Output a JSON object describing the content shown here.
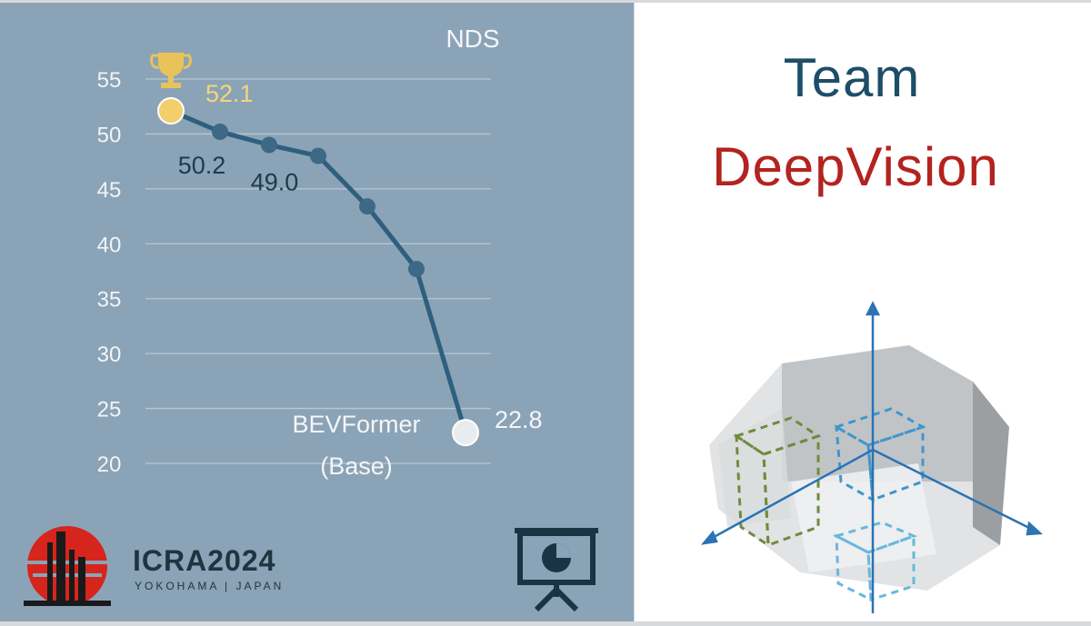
{
  "chart_data": {
    "type": "line",
    "title": "NDS",
    "y_ticks": [
      "55",
      "50",
      "45",
      "40",
      "35",
      "30",
      "25",
      "20"
    ],
    "ylim": [
      20,
      55
    ],
    "grid": true,
    "series": [
      {
        "values": [
          52.1,
          50.2,
          49.0,
          48.0,
          43.4,
          37.7,
          22.8
        ],
        "point_colors": [
          "#f2cf6b",
          "#3d6986",
          "#3d6986",
          "#3d6986",
          "#3d6986",
          "#3d6986",
          "#e9ecef"
        ]
      }
    ],
    "annotations": [
      {
        "point": 0,
        "text": "52.1",
        "color": "#f5d57c"
      },
      {
        "point": 1,
        "text": "50.2",
        "color": "#1f3a4c"
      },
      {
        "point": 2,
        "text": "49.0",
        "color": "#1f3a4c"
      },
      {
        "point": 6,
        "text": "22.8",
        "color": "#f4f6f8"
      }
    ],
    "baseline_label": {
      "line1": "BEVFormer",
      "line2": "(Base)"
    },
    "trophy_icon": "trophy-icon",
    "line_color": "#2f5f7f"
  },
  "team": {
    "line1": "Team",
    "line2": "DeepVision"
  },
  "logo": {
    "name": "ICRA2024",
    "sub": "YOKOHAMA | JAPAN"
  },
  "icons": {
    "presentation": "presentation-board-icon",
    "illustration": "bev-3d-illustration"
  },
  "colors": {
    "panel_bg": "#8ba3b6",
    "team_color": "#1d4d67",
    "deepvision_color": "#b3231f",
    "logo_red": "#d6251d"
  }
}
